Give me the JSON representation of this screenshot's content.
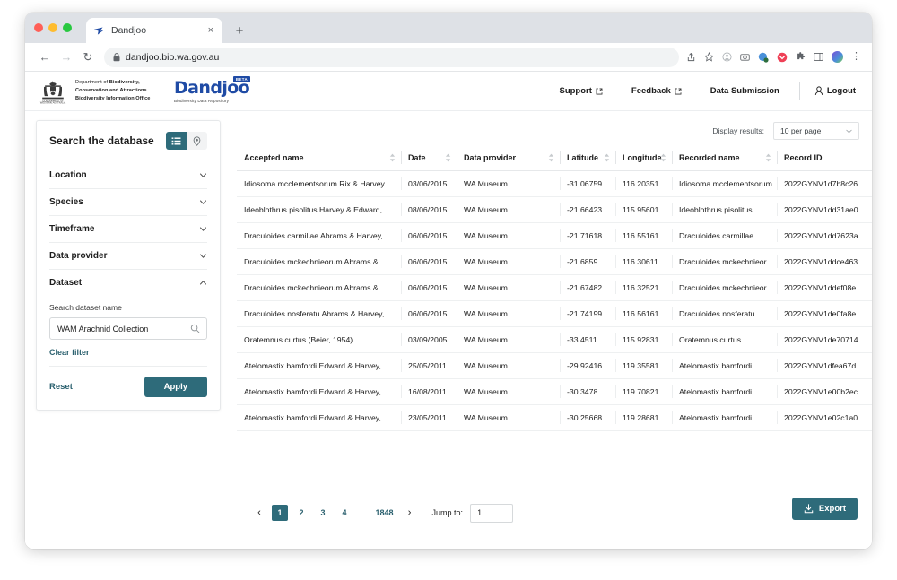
{
  "browser": {
    "tab": {
      "title": "Dandjoo",
      "favicon": "dandjoo-favicon",
      "close": "×"
    },
    "new_tab": "+",
    "back": "←",
    "forward": "→",
    "reload": "↻",
    "lock": "🔒",
    "url": "dandjoo.bio.wa.gov.au",
    "toolbar_icons": [
      "share-icon",
      "bookmark-star-icon",
      "extension-puzzle-icon",
      "camera-icon",
      "profile-badge-icon",
      "reading-list-icon",
      "puzzle-icon",
      "sidebar-icon",
      "account-avatar-icon",
      "chrome-menu-icon"
    ],
    "menu": "⋮"
  },
  "header": {
    "department": {
      "line1_prefix": "Department of ",
      "line1_bold": "Biodiversity,",
      "line2": "Conservation and Attractions",
      "line3": "Biodiversity Information Office"
    },
    "logo": {
      "word": "Dandjoo",
      "badge": "BETA",
      "tagline": "Biodiversity Data Repository"
    },
    "nav": [
      {
        "label": "Support",
        "external": true
      },
      {
        "label": "Feedback",
        "external": true
      },
      {
        "label": "Data Submission",
        "external": false
      }
    ],
    "logout": "Logout"
  },
  "sidebar": {
    "title": "Search the database",
    "view_toggle": [
      {
        "name": "list-view",
        "icon": "list-icon",
        "active": true
      },
      {
        "name": "map-view",
        "icon": "map-pin-icon",
        "active": false
      }
    ],
    "accordion": [
      {
        "label": "Location",
        "expanded": false
      },
      {
        "label": "Species",
        "expanded": false
      },
      {
        "label": "Timeframe",
        "expanded": false
      },
      {
        "label": "Data provider",
        "expanded": false
      },
      {
        "label": "Dataset",
        "expanded": true
      }
    ],
    "dataset_panel": {
      "field_label": "Search dataset name",
      "field_value": "WAM Arachnid Collection",
      "field_placeholder": "Search dataset name",
      "clear_filter": "Clear filter"
    },
    "reset": "Reset",
    "apply": "Apply"
  },
  "results": {
    "display_label": "Display results:",
    "per_page": "10 per page",
    "columns": [
      {
        "key": "accepted_name",
        "label": "Accepted name",
        "sortable": true
      },
      {
        "key": "date",
        "label": "Date",
        "sortable": true
      },
      {
        "key": "data_provider",
        "label": "Data provider",
        "sortable": true
      },
      {
        "key": "latitude",
        "label": "Latitude",
        "sortable": true
      },
      {
        "key": "longitude",
        "label": "Longitude",
        "sortable": true
      },
      {
        "key": "recorded_name",
        "label": "Recorded name",
        "sortable": true
      },
      {
        "key": "record_id",
        "label": "Record ID",
        "sortable": false
      }
    ],
    "rows": [
      {
        "accepted_name": "Idiosoma mcclementsorum Rix & Harvey...",
        "date": "03/06/2015",
        "data_provider": "WA Museum",
        "latitude": "-31.06759",
        "longitude": "116.20351",
        "recorded_name": "Idiosoma mcclementsorum",
        "record_id": "2022GYNV1d7b8c26"
      },
      {
        "accepted_name": "Ideoblothrus pisolitus Harvey & Edward, ...",
        "date": "08/06/2015",
        "data_provider": "WA Museum",
        "latitude": "-21.66423",
        "longitude": "115.95601",
        "recorded_name": "Ideoblothrus pisolitus",
        "record_id": "2022GYNV1dd31ae0"
      },
      {
        "accepted_name": "Draculoides carmillae Abrams & Harvey, ...",
        "date": "06/06/2015",
        "data_provider": "WA Museum",
        "latitude": "-21.71618",
        "longitude": "116.55161",
        "recorded_name": "Draculoides carmillae",
        "record_id": "2022GYNV1dd7623a"
      },
      {
        "accepted_name": "Draculoides mckechnieorum Abrams & ...",
        "date": "06/06/2015",
        "data_provider": "WA Museum",
        "latitude": "-21.6859",
        "longitude": "116.30611",
        "recorded_name": "Draculoides mckechnieor...",
        "record_id": "2022GYNV1ddce463"
      },
      {
        "accepted_name": "Draculoides mckechnieorum Abrams & ...",
        "date": "06/06/2015",
        "data_provider": "WA Museum",
        "latitude": "-21.67482",
        "longitude": "116.32521",
        "recorded_name": "Draculoides mckechnieor...",
        "record_id": "2022GYNV1ddef08e"
      },
      {
        "accepted_name": "Draculoides nosferatu Abrams & Harvey,...",
        "date": "06/06/2015",
        "data_provider": "WA Museum",
        "latitude": "-21.74199",
        "longitude": "116.56161",
        "recorded_name": "Draculoides nosferatu",
        "record_id": "2022GYNV1de0fa8e"
      },
      {
        "accepted_name": "Oratemnus curtus (Beier, 1954)",
        "date": "03/09/2005",
        "data_provider": "WA Museum",
        "latitude": "-33.4511",
        "longitude": "115.92831",
        "recorded_name": "Oratemnus curtus",
        "record_id": "2022GYNV1de70714"
      },
      {
        "accepted_name": "Atelomastix bamfordi Edward & Harvey, ...",
        "date": "25/05/2011",
        "data_provider": "WA Museum",
        "latitude": "-29.92416",
        "longitude": "119.35581",
        "recorded_name": "Atelomastix bamfordi",
        "record_id": "2022GYNV1dfea67d"
      },
      {
        "accepted_name": "Atelomastix bamfordi Edward & Harvey, ...",
        "date": "16/08/2011",
        "data_provider": "WA Museum",
        "latitude": "-30.3478",
        "longitude": "119.70821",
        "recorded_name": "Atelomastix bamfordi",
        "record_id": "2022GYNV1e00b2ec"
      },
      {
        "accepted_name": "Atelomastix bamfordi Edward & Harvey, ...",
        "date": "23/05/2011",
        "data_provider": "WA Museum",
        "latitude": "-30.25668",
        "longitude": "119.28681",
        "recorded_name": "Atelomastix bamfordi",
        "record_id": "2022GYNV1e02c1a0"
      }
    ]
  },
  "pagination": {
    "prev": "‹",
    "next": "›",
    "pages": [
      "1",
      "2",
      "3",
      "4"
    ],
    "ellipsis": "...",
    "last_page": "1848",
    "current": "1",
    "jump_label": "Jump to:",
    "jump_value": "1"
  },
  "export": {
    "label": "Export",
    "icon": "download-icon"
  },
  "colors": {
    "teal": "#2e6b7a",
    "link_teal": "#2d6270",
    "brand_blue": "#1f4ba5"
  }
}
